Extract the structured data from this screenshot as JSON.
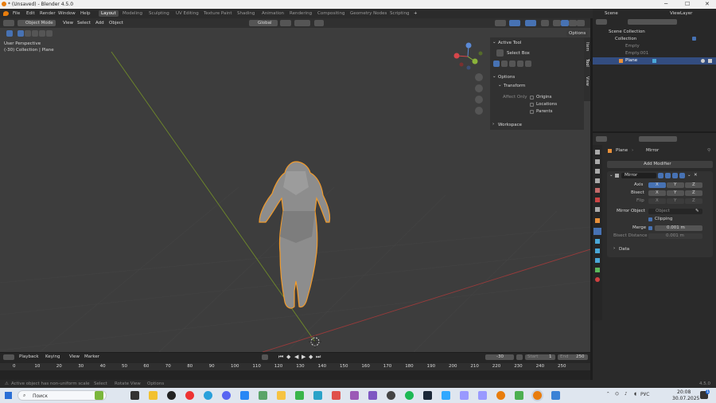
{
  "titlebar": {
    "title": "* (Unsaved) - Blender 4.5.0",
    "minimize": "─",
    "maximize": "☐",
    "close": "✕"
  },
  "menu": {
    "items": [
      "File",
      "Edit",
      "Render",
      "Window",
      "Help"
    ],
    "workspaces": [
      "Layout",
      "Modeling",
      "Sculpting",
      "UV Editing",
      "Texture Paint",
      "Shading",
      "Animation",
      "Rendering",
      "Compositing",
      "Geometry Nodes",
      "Scripting"
    ],
    "add_tab": "+",
    "scene": "Scene",
    "view_layer": "ViewLayer"
  },
  "header": {
    "mode": "Object Mode",
    "view": "View",
    "select": "Select",
    "add": "Add",
    "object": "Object",
    "orientation": "Global",
    "options": "Options"
  },
  "viewport": {
    "perspective": "User Perspective",
    "collection_info": "(-30) Collection | Plane"
  },
  "active_tool": {
    "title": "Active Tool",
    "tool": "Select Box"
  },
  "tool_options": {
    "title": "Options",
    "transform": "Transform",
    "affect_only": "Affect Only",
    "origins": "Origins",
    "locations": "Locations",
    "parents": "Parents",
    "workspace": "Workspace"
  },
  "side_tabs": [
    "Item",
    "Tool",
    "View"
  ],
  "gizmo": {
    "x": "X",
    "y": "Y",
    "z": "Z"
  },
  "outliner": {
    "scene_collection": "Scene Collection",
    "collection": "Collection",
    "items": [
      {
        "name": "Empty"
      },
      {
        "name": "Empty.001"
      },
      {
        "name": "Plane"
      }
    ]
  },
  "properties": {
    "breadcrumb_object": "Plane",
    "breadcrumb_modifier": "Mirror",
    "add_modifier": "Add Modifier",
    "modifier_name": "Mirror",
    "axis": "Axis",
    "bisect": "Bisect",
    "flip": "Flip",
    "x": "X",
    "y": "Y",
    "z": "Z",
    "mirror_object": "Mirror Object",
    "object_placeholder": "Object",
    "clipping": "Clipping",
    "merge": "Merge",
    "merge_value": "0.001 m",
    "bisect_distance": "Bisect Distance",
    "bisect_distance_value": "0.001 m",
    "data": "Data"
  },
  "timeline": {
    "playback": "Playback",
    "keying": "Keying",
    "view": "View",
    "marker": "Marker",
    "current_frame": "-30",
    "start_label": "Start",
    "start": "1",
    "end_label": "End",
    "end": "250",
    "ticks": [
      "0",
      "10",
      "20",
      "30",
      "40",
      "50",
      "60",
      "70",
      "80",
      "90",
      "100",
      "110",
      "120",
      "130",
      "140",
      "150",
      "160",
      "170",
      "180",
      "190",
      "200",
      "210",
      "220",
      "230",
      "240",
      "250"
    ]
  },
  "statusbar": {
    "warning": "Active object has non-uniform scale",
    "select": "Select",
    "rotate": "Rotate View",
    "options": "Options",
    "version": "4.5.0"
  },
  "taskbar": {
    "search": "Поиск",
    "lang": "РУС",
    "time": "20:08",
    "date": "30.07.2025",
    "notification": "1"
  }
}
